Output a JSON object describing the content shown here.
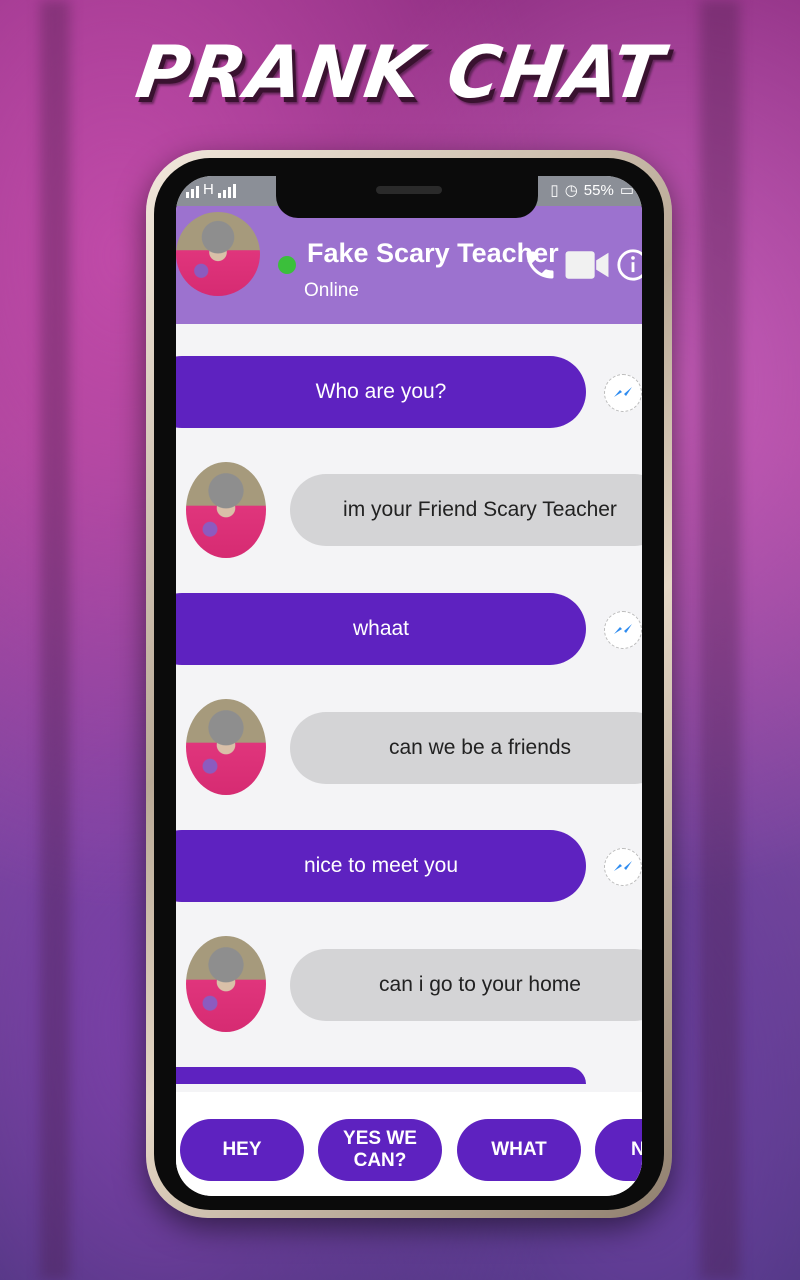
{
  "promo_title": "PRANK CHAT",
  "status_bar": {
    "network": "H",
    "battery": "55%",
    "icons": [
      "signal-icon",
      "alarm-icon",
      "vibrate-icon",
      "battery-icon"
    ]
  },
  "header": {
    "contact_name": "Fake Scary Teacher",
    "status": "Online",
    "online_color": "#3bbf3b",
    "actions": [
      "phone-icon",
      "video-call-icon",
      "info-icon"
    ]
  },
  "colors": {
    "header_bg": "#9c72cf",
    "sent_bubble": "#5e22c0",
    "received_bubble": "#d4d4d6",
    "chat_bg": "#f4f4f6"
  },
  "messages": [
    {
      "side": "sent",
      "text": "Who are you?"
    },
    {
      "side": "received",
      "text": "im your Friend Scary Teacher"
    },
    {
      "side": "sent",
      "text": "whaat"
    },
    {
      "side": "received",
      "text": "can we be a friends"
    },
    {
      "side": "sent",
      "text": "nice to meet you"
    },
    {
      "side": "received",
      "text": "can i go to your home"
    },
    {
      "side": "sent",
      "text": ""
    }
  ],
  "quick_replies": [
    "HEY",
    "YES WE CAN?",
    "WHAT",
    "N"
  ]
}
